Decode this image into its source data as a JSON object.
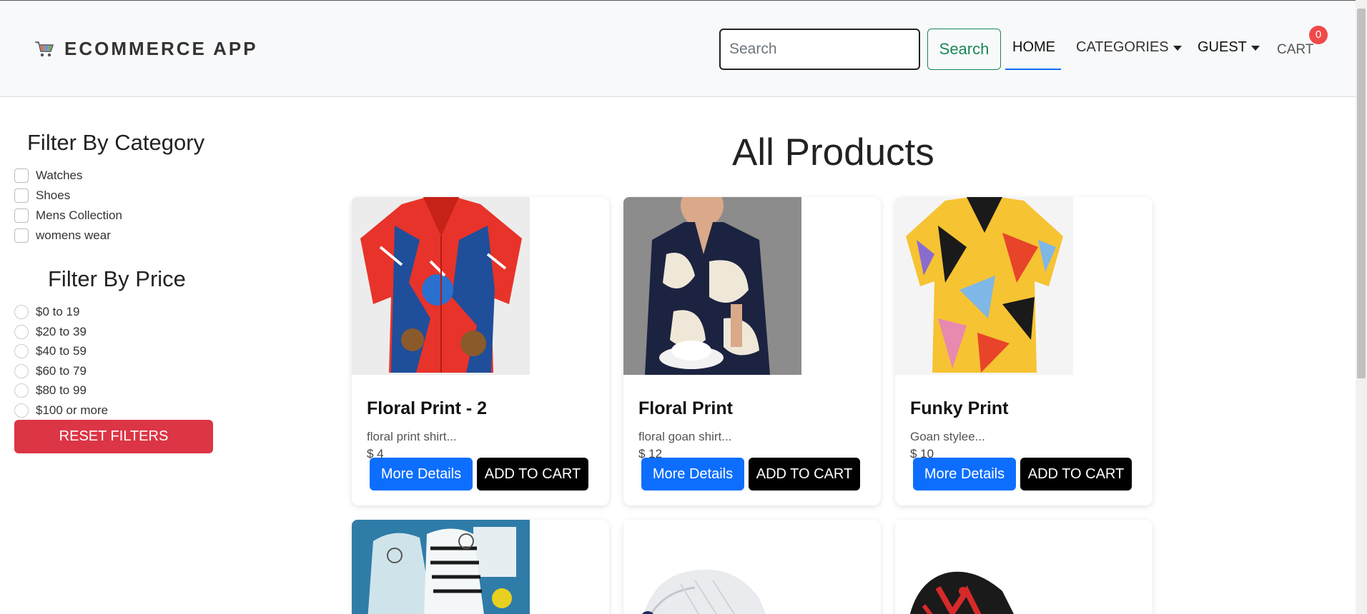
{
  "brand": {
    "name": "ECOMMERCE APP",
    "icon": "shopping-cart-icon"
  },
  "search": {
    "placeholder": "Search",
    "value": "",
    "button_label": "Search"
  },
  "nav": {
    "home": "HOME",
    "categories": "CATEGORIES",
    "user": "GUEST",
    "cart": "CART",
    "cart_count": "0"
  },
  "sidebar": {
    "category_heading": "Filter By Category",
    "categories": [
      {
        "label": "Watches",
        "checked": false
      },
      {
        "label": "Shoes",
        "checked": false
      },
      {
        "label": "Mens Collection",
        "checked": false
      },
      {
        "label": "womens wear",
        "checked": false
      }
    ],
    "price_heading": "Filter By Price",
    "prices": [
      {
        "label": "$0 to 19",
        "checked": false
      },
      {
        "label": "$20 to 39",
        "checked": false
      },
      {
        "label": "$40 to 59",
        "checked": false
      },
      {
        "label": "$60 to 79",
        "checked": false
      },
      {
        "label": "$80 to 99",
        "checked": false
      },
      {
        "label": "$100 or more",
        "checked": false
      }
    ],
    "reset_label": "RESET FILTERS"
  },
  "main": {
    "title": "All Products",
    "products": [
      {
        "name": "Floral Print - 2",
        "description": "floral print shirt...",
        "price": "$ 4",
        "details_label": "More Details",
        "cart_label": "ADD TO CART"
      },
      {
        "name": "Floral Print",
        "description": "floral goan shirt...",
        "price": "$ 12",
        "details_label": "More Details",
        "cart_label": "ADD TO CART"
      },
      {
        "name": "Funky Print",
        "description": "Goan stylee...",
        "price": "$ 10",
        "details_label": "More Details",
        "cart_label": "ADD TO CART"
      }
    ]
  },
  "colors": {
    "primary": "#0d6efd",
    "danger": "#dc3545",
    "success": "#198754",
    "badge": "#f04a4a",
    "navbar_bg": "#f8f9fa"
  }
}
